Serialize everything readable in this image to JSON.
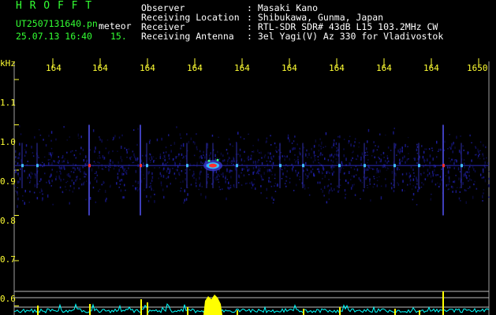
{
  "title_left": "H R O F F T",
  "filename": "UT2507131640.pn",
  "event_label": "meteor",
  "datetime": "25.07.13 16:40",
  "seconds": "15.",
  "header": [
    {
      "key": "Observer",
      "value": ": Masaki Kano"
    },
    {
      "key": "Receiving Location",
      "value": ": Shibukawa, Gunma, Japan"
    },
    {
      "key": "Receiver",
      "value": ": RTL-SDR SDR# 43dB L15 103.2MHz CW"
    },
    {
      "key": "Receiving Antenna",
      "value": ": 3el Yagi(V) Az 330 for Vladivostok"
    }
  ],
  "chart_data": {
    "type": "heatmap",
    "ylabel": "kHz",
    "y_ticks": [
      "1.1",
      "1.0",
      "0.9",
      "0.8",
      "0.7",
      "0.6"
    ],
    "x_ticks": [
      "164",
      "164",
      "164",
      "164",
      "164",
      "164",
      "164",
      "164",
      "164",
      "1650"
    ],
    "ylim": [
      0.58,
      1.14
    ],
    "signal_band_khz": [
      0.83,
      0.98
    ],
    "carrier_khz": 0.91,
    "echoes": [
      {
        "label": "meteor",
        "freq_khz": 0.91,
        "strength": "strong"
      }
    ]
  },
  "colors": {
    "background": "#000000",
    "grid": "#a0a0a0",
    "ticks": "#ffff33",
    "title": "#33ff33",
    "noise_floor": "#00ffff",
    "echo_bars": "#ffff00"
  }
}
